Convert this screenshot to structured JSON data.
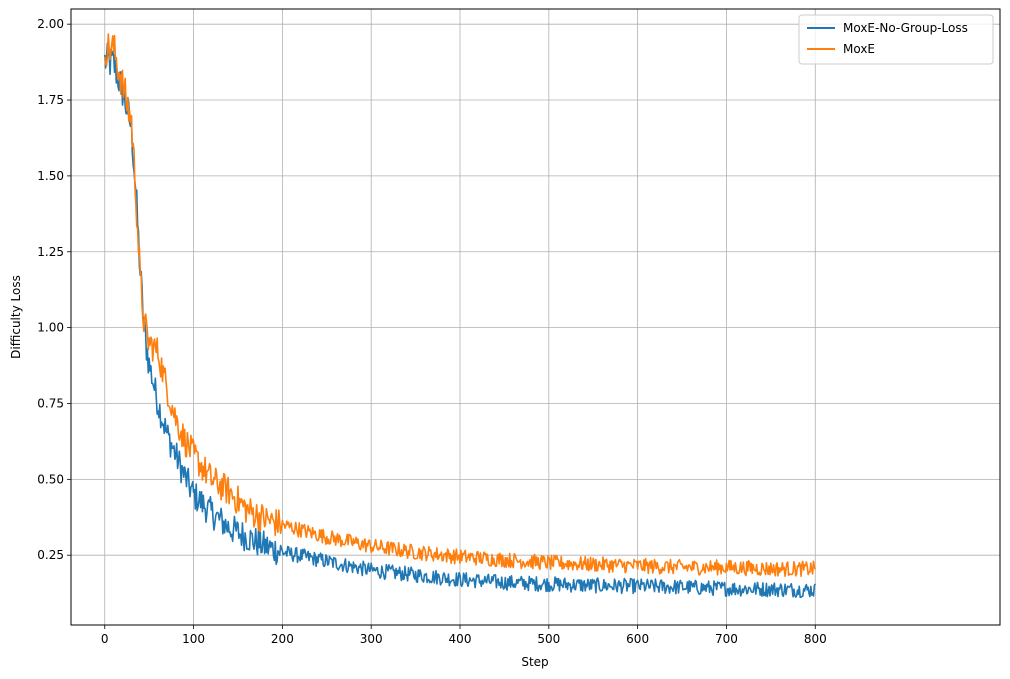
{
  "chart_data": {
    "type": "line",
    "xlabel": "Step",
    "ylabel": "Difficulty Loss",
    "xlim": [
      -38,
      1008
    ],
    "ylim": [
      0.02,
      2.05
    ],
    "xticks": [
      0,
      100,
      200,
      300,
      400,
      500,
      600,
      700,
      800
    ],
    "yticks": [
      0.25,
      0.5,
      0.75,
      1.0,
      1.25,
      1.5,
      1.75,
      2.0
    ],
    "grid": true,
    "legend_position": "top-right",
    "series": [
      {
        "name": "MoxE-No-Group-Loss",
        "color": "#1f77b4",
        "x": [
          0,
          10,
          20,
          30,
          35,
          40,
          45,
          50,
          60,
          70,
          80,
          90,
          100,
          120,
          140,
          160,
          180,
          200,
          250,
          300,
          350,
          400,
          450,
          500,
          550,
          600,
          650,
          700,
          750,
          800
        ],
        "y": [
          1.88,
          1.87,
          1.78,
          1.66,
          1.45,
          1.18,
          0.98,
          0.88,
          0.75,
          0.65,
          0.58,
          0.51,
          0.45,
          0.39,
          0.34,
          0.31,
          0.28,
          0.26,
          0.23,
          0.2,
          0.185,
          0.17,
          0.16,
          0.155,
          0.15,
          0.148,
          0.145,
          0.14,
          0.138,
          0.135
        ]
      },
      {
        "name": "MoxE",
        "color": "#ff7f0e",
        "x": [
          0,
          10,
          20,
          30,
          35,
          40,
          45,
          50,
          60,
          70,
          80,
          90,
          100,
          120,
          140,
          160,
          180,
          200,
          250,
          300,
          350,
          400,
          450,
          500,
          550,
          600,
          650,
          700,
          750,
          800
        ],
        "y": [
          1.92,
          1.92,
          1.8,
          1.68,
          1.45,
          1.15,
          1.0,
          0.95,
          0.92,
          0.8,
          0.7,
          0.63,
          0.58,
          0.5,
          0.46,
          0.4,
          0.37,
          0.35,
          0.31,
          0.28,
          0.26,
          0.245,
          0.235,
          0.225,
          0.22,
          0.215,
          0.21,
          0.21,
          0.205,
          0.205
        ]
      }
    ]
  }
}
